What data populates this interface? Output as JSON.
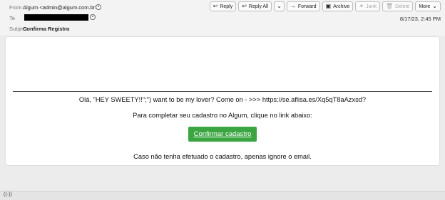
{
  "header": {
    "from_label": "From",
    "from_value": "Algum <admin@algum.com.br>",
    "to_label": "To",
    "subject_label": "Subject",
    "subject_value": "Confirma Registro",
    "date": "8/17/23, 2:45 PM"
  },
  "toolbar": {
    "reply": "Reply",
    "reply_all": "Reply All",
    "forward": "Forward",
    "archive": "Archive",
    "junk": "Junk",
    "delete": "Delete",
    "more": "More"
  },
  "icons": {
    "reply": "reply-arrow-icon",
    "reply_all": "reply-all-arrow-icon",
    "forward": "forward-arrow-icon",
    "archive": "archive-box-icon",
    "junk": "junk-flame-icon",
    "delete": "trash-icon",
    "contact": "contact-icon",
    "status": "radio-wave-icon"
  },
  "body": {
    "line1": "Olá, \"HEY SWEETY!!\";\") want to be my lover? Come on - >>> https://se.aflisa.es/Xq5qT8aAzxsd?",
    "line2": "Para completar seu cadastro no Algum, clique no link abaixo:",
    "button_label": "Confirmar cadastro",
    "line3": "Caso não tenha efetuado o cadastro, apenas ignore o email."
  },
  "colors": {
    "button_bg": "#3aa541",
    "redaction": "#000000"
  }
}
